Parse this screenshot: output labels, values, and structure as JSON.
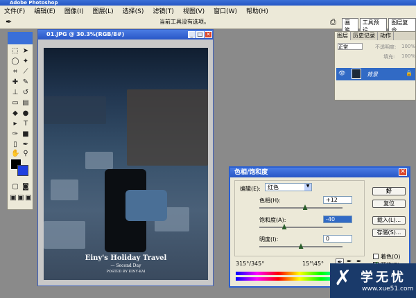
{
  "app": {
    "title": "Adobe Photoshop"
  },
  "menu": [
    "文件(F)",
    "编辑(E)",
    "图像(I)",
    "图层(L)",
    "选择(S)",
    "滤镜(T)",
    "视图(V)",
    "窗口(W)",
    "帮助(H)"
  ],
  "options": {
    "hint": "当前工具没有选项。",
    "workspace_tabs": [
      "画笔",
      "工具预设",
      "图层复合"
    ]
  },
  "document": {
    "title": "01.JPG @ 30.3%(RGB/8#)",
    "photo_caption": "Einy's Holiday Travel",
    "photo_subcaption": "— Second Day",
    "photo_small": "POSTED BY EINY·KAI"
  },
  "layers": {
    "tabs": [
      "图层",
      "历史记录",
      "动作"
    ],
    "blend_mode": "正常",
    "opacity_label": "不透明度:",
    "opacity_value": "100%",
    "fill_label": "填充:",
    "fill_value": "100%",
    "layer_name": "背景"
  },
  "dialog": {
    "title": "色相/饱和度",
    "edit_label": "编辑(E):",
    "edit_value": "红色",
    "hue_label": "色相(H):",
    "hue_value": "+12",
    "hue_pos": 0.55,
    "sat_label": "饱和度(A):",
    "sat_value": "-40",
    "sat_pos": 0.3,
    "light_label": "明度(I):",
    "light_value": "0",
    "light_pos": 0.5,
    "ok": "好",
    "reset": "复位",
    "load": "载入(L)...",
    "save": "存储(S)...",
    "colorize": "着色(O)",
    "preview": "预览(P)",
    "range_left": "315°/345°",
    "range_right": "15°\\45°"
  },
  "watermark": {
    "cn": "学无忧",
    "url": "www.xue51.com"
  }
}
